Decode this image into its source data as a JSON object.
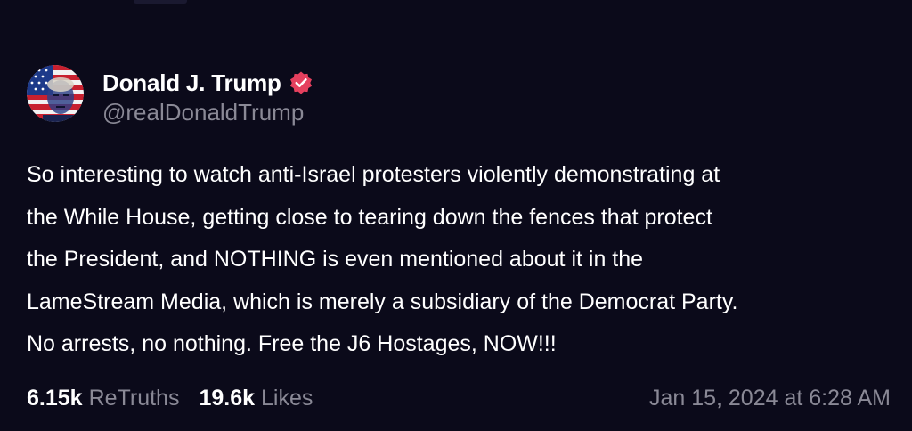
{
  "author": {
    "display_name": "Donald J. Trump",
    "handle": "@realDonaldTrump",
    "avatar_icon": "flag-portrait-avatar",
    "verified_icon": "verified-badge-icon",
    "verified_color": "#e5405e"
  },
  "post": {
    "lines": [
      "So interesting to watch anti-Israel protesters violently demonstrating at",
      "the While House, getting close to tearing down the fences that protect",
      "the President, and NOTHING is even mentioned about it in the",
      "LameStream Media, which is merely a subsidiary of the Democrat Party.",
      "No arrests, no nothing. Free the J6 Hostages, NOW!!!"
    ]
  },
  "stats": {
    "retruths_count": "6.15k",
    "retruths_label": "ReTruths",
    "likes_count": "19.6k",
    "likes_label": "Likes"
  },
  "timestamp": "Jan 15, 2024 at 6:28 AM",
  "colors": {
    "background": "#0b0a1a",
    "text": "#ffffff",
    "muted": "#8a8996"
  }
}
